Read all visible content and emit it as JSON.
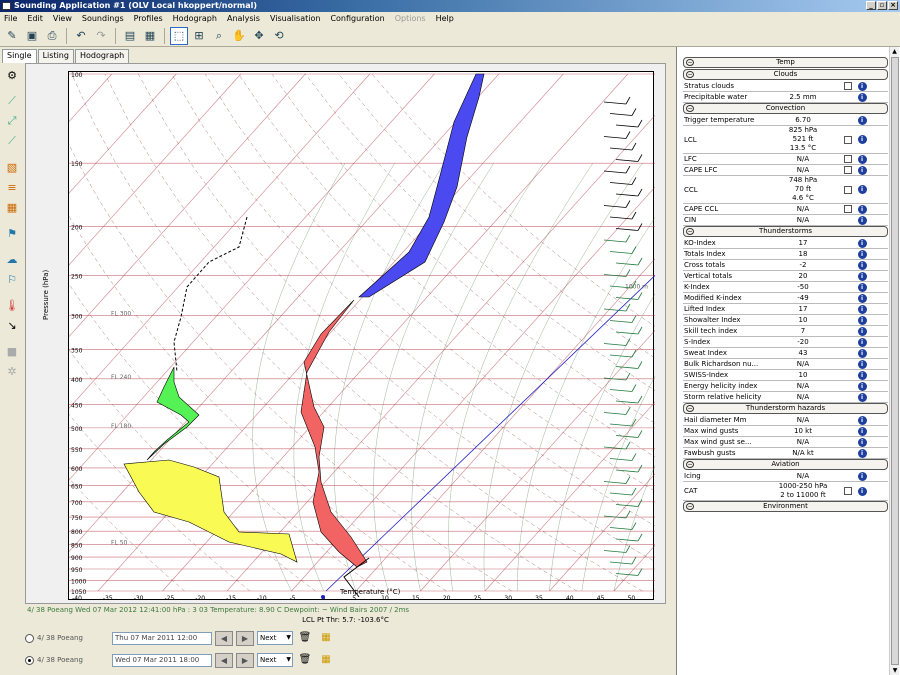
{
  "window": {
    "title": "Sounding Application #1 (OLV Local hkoppert/normal)",
    "controls": [
      "_",
      "▫",
      "×"
    ]
  },
  "menu": [
    "File",
    "Edit",
    "View",
    "Soundings",
    "Profiles",
    "Hodograph",
    "Analysis",
    "Visualisation",
    "Configuration",
    "Options",
    "Help"
  ],
  "menu_disabled": [
    "Options"
  ],
  "tabs": [
    "Single",
    "Listing",
    "Hodograph"
  ],
  "plot": {
    "ylabel": "Pressure (hPa)",
    "xlabel": "Temperature (°C)",
    "pressure_ticks": [
      "100",
      "150",
      "200",
      "250",
      "300",
      "350",
      "400",
      "450",
      "500",
      "550",
      "600",
      "650",
      "700",
      "750",
      "800",
      "850",
      "900",
      "950",
      "1000",
      "1050"
    ],
    "temp_ticks": [
      "-40",
      "-35",
      "-30",
      "-25",
      "-20",
      "-15",
      "-10",
      "-5",
      "0",
      "5",
      "10",
      "15",
      "20",
      "25",
      "30",
      "35",
      "40",
      "45",
      "50"
    ],
    "fl_labels": [
      "FL 300",
      "FL 240",
      "FL 180",
      "FL 50"
    ],
    "height_label": "1000 m",
    "status_line": "4/ 38 Poeang Wed 07 Mar 2012 12:41:00 hPa  : 3 03 Temperature: 8.90 C Dewpoint:  ~  Wind Bairs 2007 / 2ms",
    "lcl_line": "LCL Pt Thr: 5.7: -103.6°C"
  },
  "loads": [
    {
      "label": "4/ 38 Poeang",
      "time": "Thu 07 Mar 2011 12:00",
      "select": "Next",
      "selected": false
    },
    {
      "label": "4/ 38 Poeang",
      "time": "Wed 07 Mar 2011 18:00",
      "select": "Next",
      "selected": true
    }
  ],
  "panel": {
    "sections": [
      {
        "title": "Temp",
        "rows": []
      },
      {
        "title": "Clouds",
        "rows": [
          {
            "label": "Stratus clouds",
            "value": "",
            "check": true
          },
          {
            "label": "Precipitable water",
            "value": "2.5 mm",
            "check": false
          }
        ]
      },
      {
        "title": "Convection",
        "rows": [
          {
            "label": "Trigger temperature",
            "value": "6.70",
            "check": false
          },
          {
            "label": "LCL",
            "value": "825 hPa\n521 ft\n13.5 °C",
            "check": true
          },
          {
            "label": "LFC",
            "value": "N/A",
            "check": true
          },
          {
            "label": "CAPE LFC",
            "value": "N/A",
            "check": true
          },
          {
            "label": "CCL",
            "value": "748 hPa\n70 ft\n4.6 °C",
            "check": true
          },
          {
            "label": "CAPE CCL",
            "value": "N/A",
            "check": true
          },
          {
            "label": "CIN",
            "value": "N/A",
            "check": false
          }
        ]
      },
      {
        "title": "Thunderstorms",
        "rows": [
          {
            "label": "KO-Index",
            "value": "17",
            "check": false
          },
          {
            "label": "Totals Index",
            "value": "18",
            "check": false
          },
          {
            "label": "Cross totals",
            "value": "-2",
            "check": false
          },
          {
            "label": "Vertical totals",
            "value": "20",
            "check": false
          },
          {
            "label": "K-Index",
            "value": "-50",
            "check": false
          },
          {
            "label": "Modified K-index",
            "value": "-49",
            "check": false
          },
          {
            "label": "Lifted Index",
            "value": "17",
            "check": false
          },
          {
            "label": "Showalter Index",
            "value": "10",
            "check": false
          },
          {
            "label": "Skill tech index",
            "value": "7",
            "check": false
          },
          {
            "label": "S-Index",
            "value": "-20",
            "check": false
          },
          {
            "label": "Sweat Index",
            "value": "43",
            "check": false
          },
          {
            "label": "Bulk Richardson nu...",
            "value": "N/A",
            "check": false
          },
          {
            "label": "SWISS-Index",
            "value": "10",
            "check": false
          },
          {
            "label": "Energy helicity index",
            "value": "N/A",
            "check": false
          },
          {
            "label": "Storm relative helicity",
            "value": "N/A",
            "check": false
          }
        ]
      },
      {
        "title": "Thunderstorm hazards",
        "rows": [
          {
            "label": "Hail diameter Mm",
            "value": "N/A",
            "check": false
          },
          {
            "label": "Max wind gusts",
            "value": "10 kt",
            "check": false
          },
          {
            "label": "Max wind gust se...",
            "value": "N/A",
            "check": false
          },
          {
            "label": "Fawbush gusts",
            "value": "N/A kt",
            "check": false
          }
        ]
      },
      {
        "title": "Aviation",
        "rows": [
          {
            "label": "Icing",
            "value": "N/A",
            "check": false
          },
          {
            "label": "CAT",
            "value": "1000-250 hPa\n2 to 11000 ft",
            "check": true
          }
        ]
      },
      {
        "title": "Environment",
        "rows": []
      }
    ]
  },
  "colors": {
    "cape_blue": "#4a4af0",
    "red_area": "#f26464",
    "dew_green": "#55f255",
    "yellow_area": "#fafa55",
    "wind_green": "#1e7a3a",
    "isotherm_red": "#b0303c",
    "adiabat_green": "#3c6e3c"
  }
}
